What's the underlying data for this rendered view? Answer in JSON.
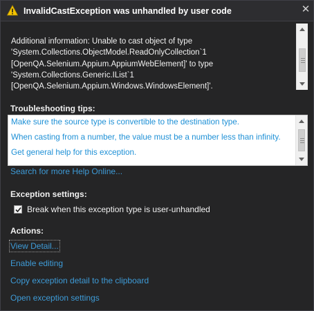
{
  "dialog": {
    "title": "InvalidCastException was unhandled by user code",
    "close_glyph": "✕"
  },
  "info": {
    "lines": [
      "Additional information: Unable to cast object of type",
      "'System.Collections.ObjectModel.ReadOnlyCollection`1",
      "[OpenQA.Selenium.Appium.AppiumWebElement]' to type",
      "'System.Collections.Generic.IList`1",
      "[OpenQA.Selenium.Appium.Windows.WindowsElement]'."
    ]
  },
  "troubleshooting": {
    "header": "Troubleshooting tips:",
    "tips": [
      "Make sure the source type is convertible to the destination type.",
      "When casting from a number, the value must be a number less than infinity.",
      "Get general help for this exception."
    ],
    "search_link": "Search for more Help Online..."
  },
  "exception_settings": {
    "header": "Exception settings:",
    "checkbox_label": "Break when this exception type is user-unhandled",
    "checked": true
  },
  "actions": {
    "header": "Actions:",
    "items": [
      "View Detail...",
      "Enable editing",
      "Copy exception detail to the clipboard",
      "Open exception settings"
    ]
  },
  "colors": {
    "background": "#252526",
    "link": "#3e9bd7",
    "tip_link": "#1e90d6",
    "warning": "#f5c400"
  }
}
